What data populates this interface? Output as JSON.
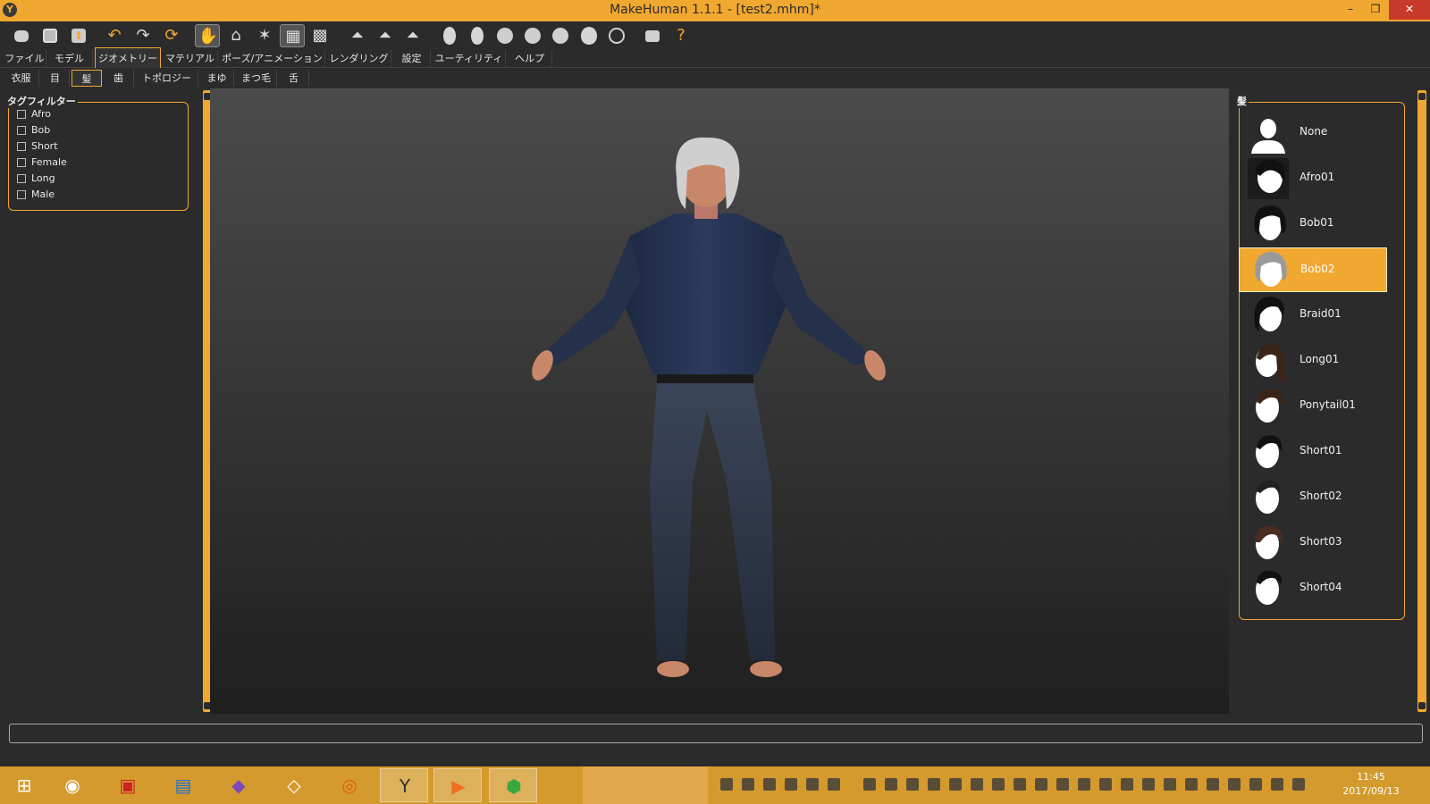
{
  "window": {
    "title": "MakeHuman 1.1.1 - [test2.mhm]*",
    "app_icon": "Y",
    "minimize_glyph": "–",
    "restore_glyph": "❐",
    "close_glyph": "✕"
  },
  "toolbar": {
    "buttons": [
      {
        "name": "new-icon"
      },
      {
        "name": "save-icon"
      },
      {
        "name": "export-icon"
      },
      {
        "name": "undo-icon"
      },
      {
        "name": "redo-icon"
      },
      {
        "name": "reset-icon"
      },
      {
        "name": "smooth-icon"
      },
      {
        "name": "wireframe-icon"
      },
      {
        "name": "pose-icon"
      },
      {
        "name": "grid-icon"
      },
      {
        "name": "background-icon"
      },
      {
        "name": "symmetry-right-icon"
      },
      {
        "name": "symmetry-left-icon"
      },
      {
        "name": "symmetry-icon"
      },
      {
        "name": "front-view-icon"
      },
      {
        "name": "back-view-icon"
      },
      {
        "name": "left-view-icon"
      },
      {
        "name": "right-view-icon"
      },
      {
        "name": "top-view-icon"
      },
      {
        "name": "bottom-view-icon"
      },
      {
        "name": "reset-camera-icon"
      },
      {
        "name": "screenshot-icon"
      },
      {
        "name": "help-icon"
      }
    ],
    "help_glyph": "?"
  },
  "main_tabs": [
    {
      "label": "ファイル"
    },
    {
      "label": "モデル"
    },
    {
      "label": "ジオメトリー",
      "active": true
    },
    {
      "label": "マテリアル"
    },
    {
      "label": "ポーズ/アニメーション"
    },
    {
      "label": "レンダリング"
    },
    {
      "label": "設定"
    },
    {
      "label": "ユーティリティ"
    },
    {
      "label": "ヘルプ"
    }
  ],
  "sub_tabs": [
    {
      "label": "衣服"
    },
    {
      "label": "目"
    },
    {
      "label": "髪",
      "active": true
    },
    {
      "label": "歯"
    },
    {
      "label": "トポロジー"
    },
    {
      "label": "まゆ"
    },
    {
      "label": "まつ毛"
    },
    {
      "label": "舌"
    }
  ],
  "tag_filter": {
    "title": "タグフィルター",
    "tags": [
      "Afro",
      "Bob",
      "Short",
      "Female",
      "Long",
      "Male"
    ]
  },
  "hair_panel": {
    "title": "髪",
    "items": [
      {
        "label": "None",
        "kind": "none"
      },
      {
        "label": "Afro01",
        "kind": "afro"
      },
      {
        "label": "Bob01",
        "kind": "bob"
      },
      {
        "label": "Bob02",
        "kind": "bob-grey",
        "selected": true
      },
      {
        "label": "Braid01",
        "kind": "braid"
      },
      {
        "label": "Long01",
        "kind": "long"
      },
      {
        "label": "Ponytail01",
        "kind": "ponytail"
      },
      {
        "label": "Short01",
        "kind": "short"
      },
      {
        "label": "Short02",
        "kind": "short"
      },
      {
        "label": "Short03",
        "kind": "short-brown"
      },
      {
        "label": "Short04",
        "kind": "short"
      }
    ],
    "selected": "Bob02"
  },
  "status_bar": {
    "text": ""
  },
  "taskbar": {
    "apps": [
      {
        "name": "windows-start-icon",
        "glyph": "⊞"
      },
      {
        "name": "speaker-app-icon",
        "glyph": "◉"
      },
      {
        "name": "paint-app-icon",
        "glyph": "▣"
      },
      {
        "name": "blue-app-icon",
        "glyph": "▤"
      },
      {
        "name": "visual-studio-icon",
        "glyph": "◆"
      },
      {
        "name": "unity-icon",
        "glyph": "◇"
      },
      {
        "name": "blender-icon",
        "glyph": "◎"
      },
      {
        "name": "makehuman-icon",
        "glyph": "Y",
        "active": true
      },
      {
        "name": "media-player-icon",
        "glyph": "▶"
      },
      {
        "name": "green-app-icon",
        "glyph": "⬢"
      }
    ],
    "clock_time": "11:45",
    "clock_date": "2017/09/13"
  },
  "colors": {
    "accent": "#f0a830",
    "background": "#2b2b2b",
    "taskbar": "#d49a2e"
  }
}
